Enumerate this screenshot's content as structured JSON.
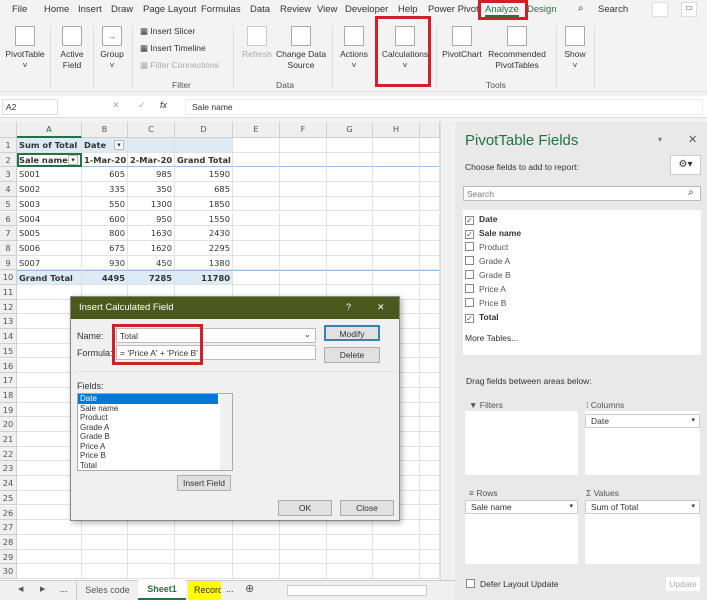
{
  "ribbon_tabs": [
    "File",
    "Home",
    "Insert",
    "Draw",
    "Page Layout",
    "Formulas",
    "Data",
    "Review",
    "View",
    "Developer",
    "Help",
    "Power Pivot",
    "Analyze",
    "Design"
  ],
  "active_tab": "Analyze",
  "search_label": "Search",
  "ribbon": {
    "pivottable": "PivotTable",
    "active_field": "Active Field",
    "group": "Group",
    "insert_slicer": "Insert Slicer",
    "insert_timeline": "Insert Timeline",
    "filter_connections": "Filter Connections",
    "filter_group": "Filter",
    "refresh": "Refresh",
    "change_data_source": "Change Data Source",
    "data_group": "Data",
    "actions": "Actions",
    "calculations": "Calculations",
    "pivotchart": "PivotChart",
    "recommended": "Recommended PivotTables",
    "tools_group": "Tools",
    "show": "Show"
  },
  "formula_bar": {
    "name_box": "A2",
    "fx": "fx",
    "content": "Sale name"
  },
  "columns": [
    "A",
    "B",
    "C",
    "D",
    "E",
    "F",
    "G",
    "H"
  ],
  "pivot": {
    "r1": [
      "Sum of Total",
      "Date"
    ],
    "header": [
      "Sale name",
      "1-Mar-20",
      "2-Mar-20",
      "Grand Total"
    ],
    "rows": [
      [
        "S001",
        "605",
        "985",
        "1590"
      ],
      [
        "S002",
        "335",
        "350",
        "685"
      ],
      [
        "S003",
        "550",
        "1300",
        "1850"
      ],
      [
        "S004",
        "600",
        "950",
        "1550"
      ],
      [
        "S005",
        "800",
        "1630",
        "2430"
      ],
      [
        "S006",
        "675",
        "1620",
        "2295"
      ],
      [
        "S007",
        "930",
        "450",
        "1380"
      ]
    ],
    "total": [
      "Grand Total",
      "4495",
      "7285",
      "11780"
    ]
  },
  "dialog": {
    "title": "Insert Calculated Field",
    "help": "?",
    "close_x": "✕",
    "name_label": "Name:",
    "name_value": "Total",
    "formula_label": "Formula:",
    "formula_value": "= 'Price A' + 'Price B'",
    "modify": "Modify",
    "delete": "Delete",
    "fields_label": "Fields:",
    "fields": [
      "Date",
      "Sale name",
      "Product",
      "Grade A",
      "Grade B",
      "Price A",
      "Price B",
      "Total"
    ],
    "insert_field": "Insert Field",
    "ok": "OK",
    "close": "Close"
  },
  "panel": {
    "title": "PivotTable Fields",
    "choose": "Choose fields to add to report:",
    "search_placeholder": "Search",
    "fields": [
      {
        "label": "Date",
        "checked": true
      },
      {
        "label": "Sale name",
        "checked": true
      },
      {
        "label": "Product",
        "checked": false
      },
      {
        "label": "Grade A",
        "checked": false
      },
      {
        "label": "Grade B",
        "checked": false
      },
      {
        "label": "Price A",
        "checked": false
      },
      {
        "label": "Price B",
        "checked": false
      },
      {
        "label": "Total",
        "checked": true
      }
    ],
    "more_tables": "More Tables...",
    "drag_label": "Drag fields between areas below:",
    "filters": "Filters",
    "columns": "Columns",
    "rows": "Rows",
    "values": "Values",
    "columns_item": "Date",
    "rows_item": "Sale name",
    "values_item": "Sum of Total",
    "defer": "Defer Layout Update",
    "update": "Update"
  },
  "sheets": {
    "tabs": [
      "Seles code",
      "Sheet1",
      "Record"
    ],
    "active": "Sheet1",
    "ellipsis": "..."
  },
  "colors": {
    "accent": "#217346",
    "highlight_red": "#d0202a",
    "dialog_title": "#4a5a1c",
    "pivot_header": "#ddebf7",
    "tab_yellow": "#ffff00"
  }
}
